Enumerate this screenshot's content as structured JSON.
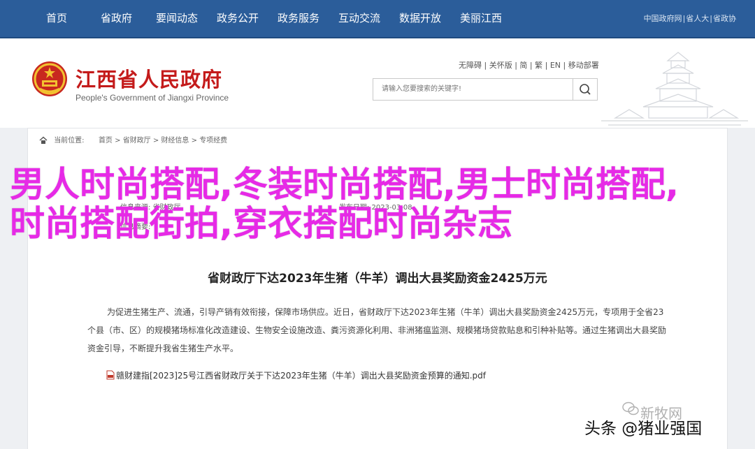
{
  "nav": {
    "items": [
      "首页",
      "省政府",
      "要闻动态",
      "政务公开",
      "政务服务",
      "互动交流",
      "数据开放",
      "美丽江西"
    ],
    "top_links": [
      "中国政府网",
      "省人大",
      "省政协"
    ]
  },
  "header": {
    "title": "江西省人民政府",
    "subtitle": "People's Government of Jiangxi Province",
    "util_links": [
      "无障碍",
      "关怀版",
      "简",
      "繁",
      "EN",
      "移动部署"
    ],
    "search_placeholder": "请输入您要搜索的关键字!"
  },
  "breadcrumb": {
    "label": "当前位置:",
    "items": [
      "首页",
      "省财政厅",
      "财经信息",
      "专项经费"
    ]
  },
  "meta": {
    "source_label": "信息来源:",
    "source_value": "省财政厅",
    "date_label": "发布日期:",
    "date_value": "2023-03-08",
    "summary_label": "信息摘要:"
  },
  "article": {
    "title": "省财政厅下达2023年生猪（牛羊）调出大县奖励资金2425万元",
    "body": "为促进生猪生产、流通，引导产销有效衔接，保障市场供应。近日，省财政厅下达2023年生猪（牛羊）调出大县奖励资金2425万元，专项用于全省23个县（市、区）的规模猪场标准化改造建设、生物安全设施改造、粪污资源化利用、非洲猪瘟监测、规模猪场贷款贴息和引种补贴等。通过生猪调出大县奖励资金引导，不断提升我省生猪生产水平。",
    "attachment": "赣财建指[2023]25号江西省财政厅关于下达2023年生猪（牛羊）调出大县奖励资金预算的通知.pdf"
  },
  "overlay": {
    "headline": "男人时尚搭配,冬装时尚搭配,男士时尚搭配,时尚搭配街拍,穿衣搭配时尚杂志",
    "watermark": "新牧网",
    "byline": "头条 @猪业强国"
  },
  "colors": {
    "nav_bg": "#2b5d9a",
    "title_red": "#c41b1b",
    "overlay_magenta": "#e62ae6"
  }
}
